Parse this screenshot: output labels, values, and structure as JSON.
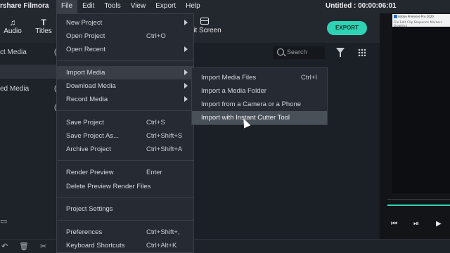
{
  "app": {
    "name": "rshare Filmora",
    "project_title": "Untitled : 00:00:06:01"
  },
  "menubar": [
    "File",
    "Edit",
    "Tools",
    "View",
    "Export",
    "Help"
  ],
  "toolbar": {
    "audio": "Audio",
    "titles": "Titles",
    "split_screen": "lit Screen",
    "export": "EXPORT"
  },
  "left_panel": {
    "item1": "ct Media",
    "item1_count": "(",
    "item2": "ed Media",
    "item2_count": "(",
    "item3_count": "("
  },
  "search": {
    "placeholder": "Search"
  },
  "file_menu": {
    "items": [
      {
        "label": "New Project",
        "shortcut": ""
      },
      {
        "label": "Open Project",
        "shortcut": "Ctrl+O"
      },
      {
        "label": "Open Recent",
        "shortcut": ""
      },
      {
        "label": "Import Media",
        "shortcut": ""
      },
      {
        "label": "Download Media",
        "shortcut": ""
      },
      {
        "label": "Record Media",
        "shortcut": ""
      },
      {
        "label": "Save Project",
        "shortcut": "Ctrl+S"
      },
      {
        "label": "Save Project As...",
        "shortcut": "Ctrl+Shift+S"
      },
      {
        "label": "Archive Project",
        "shortcut": "Ctrl+Shift+A"
      },
      {
        "label": "Render Preview",
        "shortcut": "Enter"
      },
      {
        "label": "Delete Preview Render Files",
        "shortcut": ""
      },
      {
        "label": "Project Settings",
        "shortcut": ""
      },
      {
        "label": "Preferences",
        "shortcut": "Ctrl+Shift+,"
      },
      {
        "label": "Keyboard Shortcuts",
        "shortcut": "Ctrl+Alt+K"
      }
    ]
  },
  "import_submenu": {
    "items": [
      {
        "label": "Import Media Files",
        "shortcut": "Ctrl+I"
      },
      {
        "label": "Import a Media Folder",
        "shortcut": ""
      },
      {
        "label": "Import from a Camera or a Phone",
        "shortcut": ""
      },
      {
        "label": "Import with Instant Cutter Tool",
        "shortcut": ""
      }
    ]
  },
  "preview_thumb": {
    "title": "Adobe Premiere Pro 2020",
    "menu": "File  Edit  Clip  Sequence  Markers  Graphics"
  },
  "colors": {
    "accent": "#2fd3b3",
    "background": "#1b1f26",
    "menu_bg": "#262b33",
    "highlight": "#3a3f47"
  }
}
